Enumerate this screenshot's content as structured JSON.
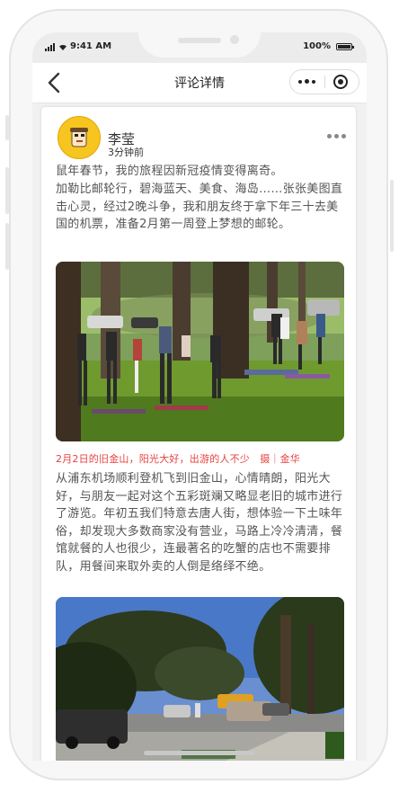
{
  "status": {
    "time": "9:41 AM",
    "battery": "100%",
    "battery_level": 1.0
  },
  "nav": {
    "title": "评论详情"
  },
  "post": {
    "author": "李莹",
    "time": "3分钟前",
    "paragraphs": [
      "鼠年春节，我的旅程因新冠疫情变得离奇。",
      "加勒比邮轮行，碧海蓝天、美食、海岛……张张美图直击心灵，经过2晚斗争，我和朋友终于拿下年三十去美国的机票，准备2月第一周登上梦想的邮轮。"
    ],
    "caption": "2月2日的旧金山，阳光大好，出游的人不少　摄｜金华",
    "paragraph2": "从浦东机场顺利登机飞到旧金山，心情晴朗，阳光大好，与朋友一起对这个五彩斑斓又略显老旧的城市进行了游览。年初五我们特意去唐人街，想体验一下土味年俗，却发现大多数商家没有营业，马路上冷冷清清，餐馆就餐的人也很少，连最著名的吃蟹的店也不需要排队，用餐间来取外卖的人倒是络绎不绝。"
  },
  "colors": {
    "caption": "#e64340",
    "avatar": "#f7c520"
  },
  "icons": {
    "back": "chevron-left-icon",
    "more": "more-dots-icon",
    "close": "target-circle-icon"
  }
}
